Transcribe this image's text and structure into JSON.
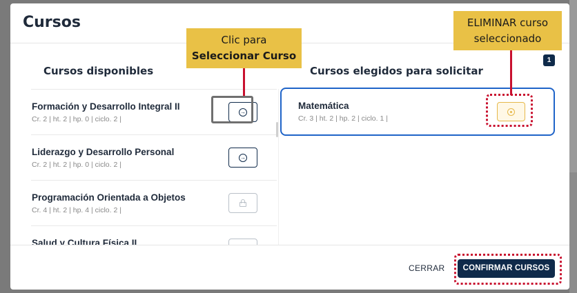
{
  "modal": {
    "title": "Cursos",
    "left_title": "Cursos disponibles",
    "right_title": "Cursos elegidos para solicitar",
    "selected_count": "1"
  },
  "available_courses": [
    {
      "name": "Formación y Desarrollo Integral II",
      "meta": "Cr. 2 |  ht. 2 |  hp. 0 |  ciclo. 2 |",
      "action_icon": "arrow-right-circle-icon",
      "locked": false
    },
    {
      "name": "Liderazgo y Desarrollo Personal",
      "meta": "Cr. 2 |  ht. 2 |  hp. 0 |  ciclo. 2 |",
      "action_icon": "arrow-right-circle-icon",
      "locked": false
    },
    {
      "name": "Programación Orientada a Objetos",
      "meta": "Cr. 4 |  ht. 2 |  hp. 4 |  ciclo. 2 |",
      "action_icon": "lock-icon",
      "locked": true
    },
    {
      "name": "Salud y Cultura Física II",
      "meta": "",
      "action_icon": "lock-icon",
      "locked": true
    }
  ],
  "selected_courses": [
    {
      "name": "Matemática",
      "meta": "Cr. 3 |  ht. 2 |  hp. 2 |  ciclo. 1 |",
      "action_icon": "remove-circle-icon"
    }
  ],
  "footer": {
    "close_label": "CERRAR",
    "confirm_label": "CONFIRMAR CURSOS"
  },
  "annotations": {
    "select_line1": "Clic para",
    "select_line2": "Seleccionar Curso",
    "remove_line1": "ELIMINAR curso",
    "remove_line2": "seleccionado"
  },
  "colors": {
    "primary": "#0f2a4a",
    "selected_border": "#1e63c8",
    "callout": "#e9c146",
    "annotation_red": "#c8102e",
    "remove_accent": "#e6b84a"
  }
}
